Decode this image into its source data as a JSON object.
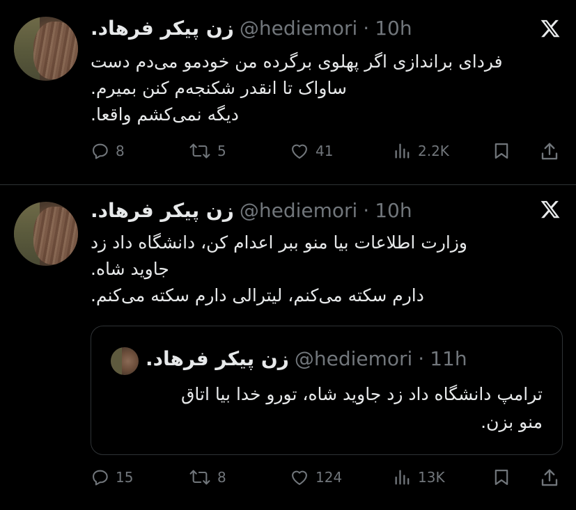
{
  "tweets": [
    {
      "author_name": "زن پیکر فرهاد.",
      "handle": "@hediemori",
      "separator": "·",
      "time": "10h",
      "lines": [
        "فردای براندازی اگر پهلوی برگرده من خودمو می‌دم دست",
        "ساواک تا انقدر شکنجه‌م کنن بمیرم.",
        "دیگه نمی‌کشم واقعا."
      ],
      "replies": "8",
      "reposts": "5",
      "likes": "41",
      "views": "2.2K"
    },
    {
      "author_name": "زن پیکر فرهاد.",
      "handle": "@hediemori",
      "separator": "·",
      "time": "10h",
      "lines": [
        "وزارت اطلاعات بیا منو ببر اعدام کن، دانشگاه داد زد",
        "جاوید شاه.",
        "دارم سکته می‌کنم، لیترالی دارم سکته می‌کنم."
      ],
      "quote": {
        "author_name": "زن پیکر فرهاد.",
        "handle": "@hediemori",
        "separator": "·",
        "time": "11h",
        "lines": [
          "ترامپ دانشگاه داد زد جاوید شاه، تورو خدا بیا اتاق",
          "منو بزن."
        ]
      },
      "replies": "15",
      "reposts": "8",
      "likes": "124",
      "views": "13K"
    }
  ],
  "icons": {
    "logo": "x-logo-icon",
    "reply": "reply-icon",
    "repost": "repost-icon",
    "like": "heart-icon",
    "views": "views-icon",
    "bookmark": "bookmark-icon",
    "share": "share-icon"
  },
  "colors": {
    "background": "#000000",
    "text": "#e7e9ea",
    "muted": "#71767b",
    "border": "#2f3336"
  }
}
